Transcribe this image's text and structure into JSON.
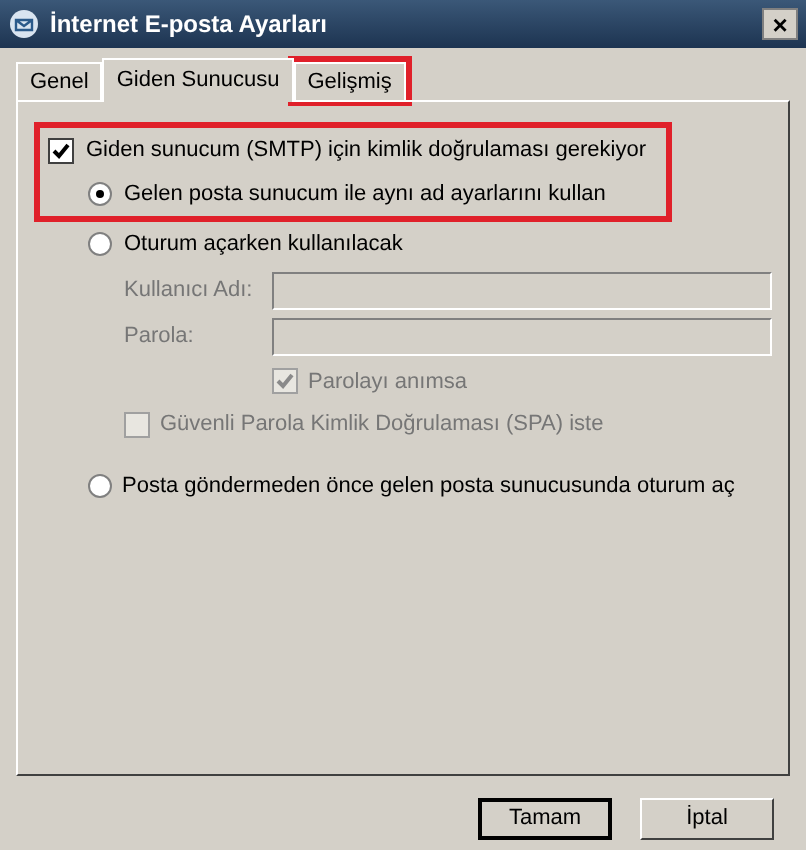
{
  "window": {
    "title": "İnternet E-posta Ayarları",
    "close": "×"
  },
  "tabs": [
    {
      "label": "Genel",
      "selected": false,
      "highlighted": false
    },
    {
      "label": "Giden Sunucusu",
      "selected": true,
      "highlighted": false
    },
    {
      "label": "Gelişmiş",
      "selected": false,
      "highlighted": true
    }
  ],
  "auth": {
    "label": "Giden sunucum (SMTP) için kimlik doğrulaması gerekiyor",
    "checked": true,
    "highlighted": true,
    "same_settings": {
      "label": "Gelen posta sunucum ile aynı ad ayarlarını kullan",
      "selected": true
    },
    "log_on_using": {
      "label": "Oturum açarken kullanılacak",
      "selected": false,
      "fields": [
        {
          "label": "Kullanıcı Adı:",
          "disabled": true
        },
        {
          "label": "Parola:",
          "disabled": true
        }
      ],
      "remember": {
        "label": "Parolayı anımsa",
        "checked": true,
        "disabled": true
      },
      "spa": {
        "label": "Güvenli Parola Kimlik Doğrulaması (SPA) iste",
        "checked": false,
        "disabled": true
      }
    },
    "log_on_before": {
      "label": "Posta göndermeden önce gelen posta sunucusunda oturum aç",
      "selected": false
    }
  },
  "buttons": [
    {
      "label": "Tamam",
      "default": true
    },
    {
      "label": "İptal",
      "default": false
    }
  ]
}
